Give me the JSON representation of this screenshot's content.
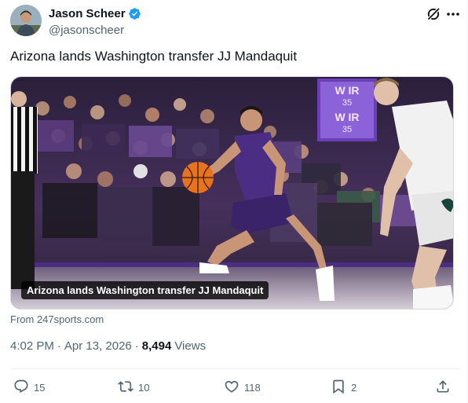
{
  "author": {
    "display_name": "Jason Scheer",
    "handle": "@jasonscheer",
    "verified": true
  },
  "tweet": {
    "text": "Arizona lands Washington transfer JJ Mandaquit"
  },
  "media": {
    "caption": "Arizona lands Washington transfer JJ Mandaquit",
    "source": "From 247sports.com",
    "scoreboard_lines": [
      "W IR",
      "W IR"
    ],
    "scoreboard_digits": [
      "35",
      "35"
    ]
  },
  "meta": {
    "time": "4:02 PM",
    "dot": "·",
    "date": "Apr 13, 2026",
    "views_count": "8,494",
    "views_label": "Views"
  },
  "actions": {
    "replies": "15",
    "reposts": "10",
    "likes": "118",
    "bookmarks": "2"
  },
  "icons": {
    "verified": "verified-badge-icon",
    "grok": "grok-icon",
    "more": "more-icon",
    "reply": "reply-icon",
    "repost": "repost-icon",
    "like": "heart-icon",
    "bookmark": "bookmark-icon",
    "share": "share-icon"
  },
  "colors": {
    "verified_blue": "#1d9bf0",
    "secondary_text": "#536471",
    "primary_text": "#0f1419",
    "washington_purple": "#4b2e83",
    "michigan_state_green": "#18453b"
  }
}
